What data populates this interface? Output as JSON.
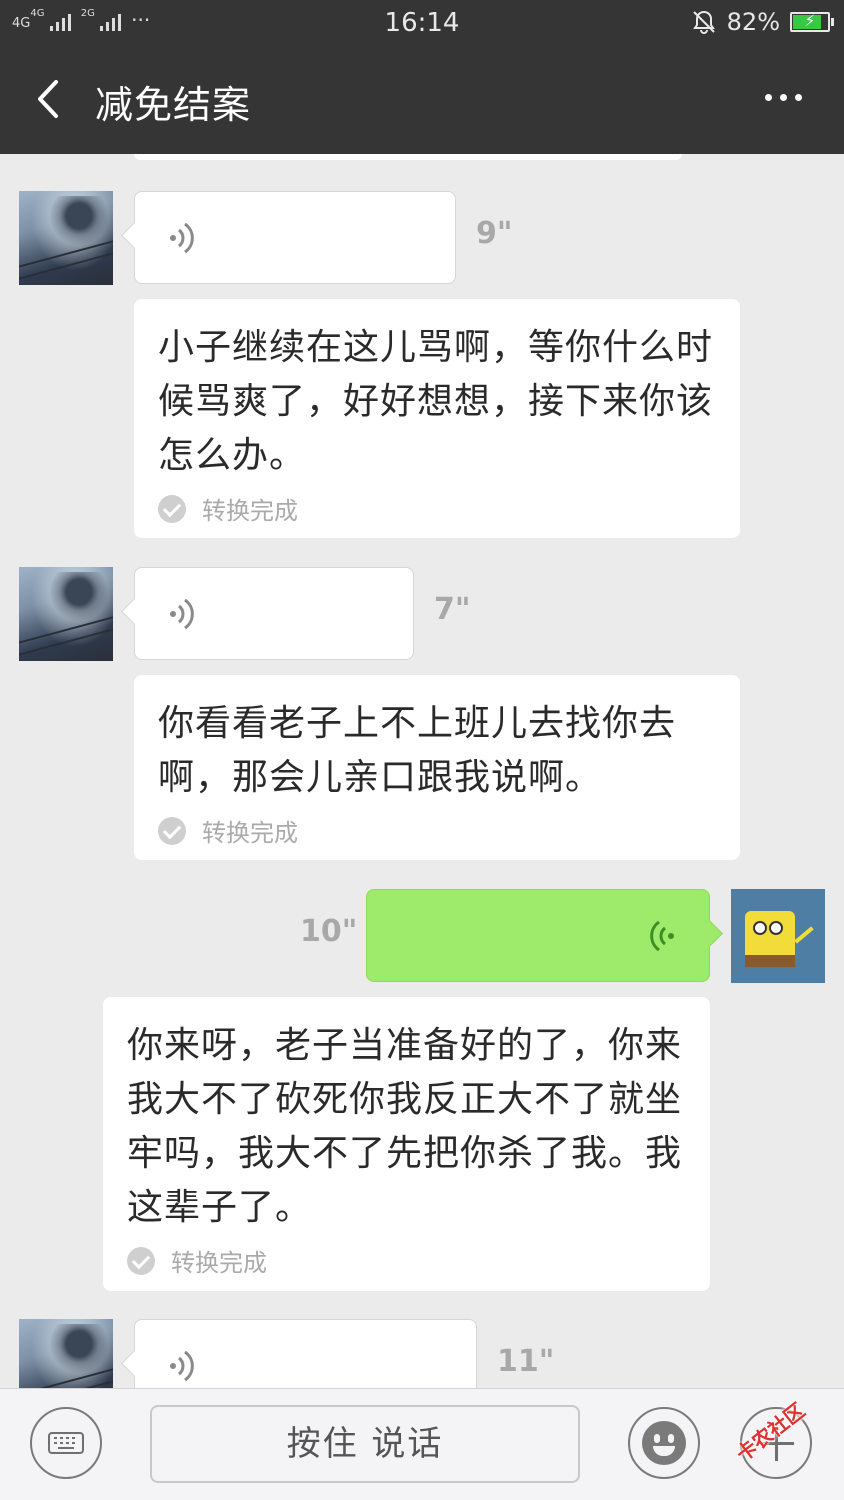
{
  "status_bar": {
    "network_left": "4G",
    "network_left2": "4G",
    "network_right": "2G",
    "extra": "···",
    "time": "16:14",
    "battery": "82%",
    "battery_level": 0.82,
    "battery_color": "#38c944"
  },
  "title_bar": {
    "title": "减免结案",
    "back_icon": "chevron-left-icon",
    "more_icon": "more-dots-icon"
  },
  "messages": [
    {
      "side": "left",
      "type": "voice",
      "duration": "9\"",
      "avatar": "scenery-avatar"
    },
    {
      "side": "left",
      "type": "transcript",
      "text": "小子继续在这儿骂啊，等你什么时候骂爽了，好好想想，接下来你该怎么办。",
      "status": "转换完成"
    },
    {
      "side": "left",
      "type": "voice",
      "duration": "7\"",
      "avatar": "scenery-avatar"
    },
    {
      "side": "left",
      "type": "transcript",
      "text": "你看看老子上不上班儿去找你去啊，那会儿亲口跟我说啊。",
      "status": "转换完成"
    },
    {
      "side": "right",
      "type": "voice",
      "duration": "10\"",
      "avatar": "spongebob-avatar",
      "bubble_color": "#9eea6a"
    },
    {
      "side": "right",
      "type": "transcript",
      "text": "你来呀，老子当准备好的了，你来我大不了砍死你我反正大不了就坐牢吗，我大不了先把你杀了我。我这辈子了。",
      "status": "转换完成"
    },
    {
      "side": "left",
      "type": "voice",
      "duration": "11\"",
      "avatar": "scenery-avatar"
    }
  ],
  "bottom_bar": {
    "keyboard_icon": "keyboard-icon",
    "hold_to_talk": "按住 说话",
    "emoji_icon": "emoji-icon",
    "plus_icon": "plus-icon"
  },
  "watermark": "卡农社区"
}
